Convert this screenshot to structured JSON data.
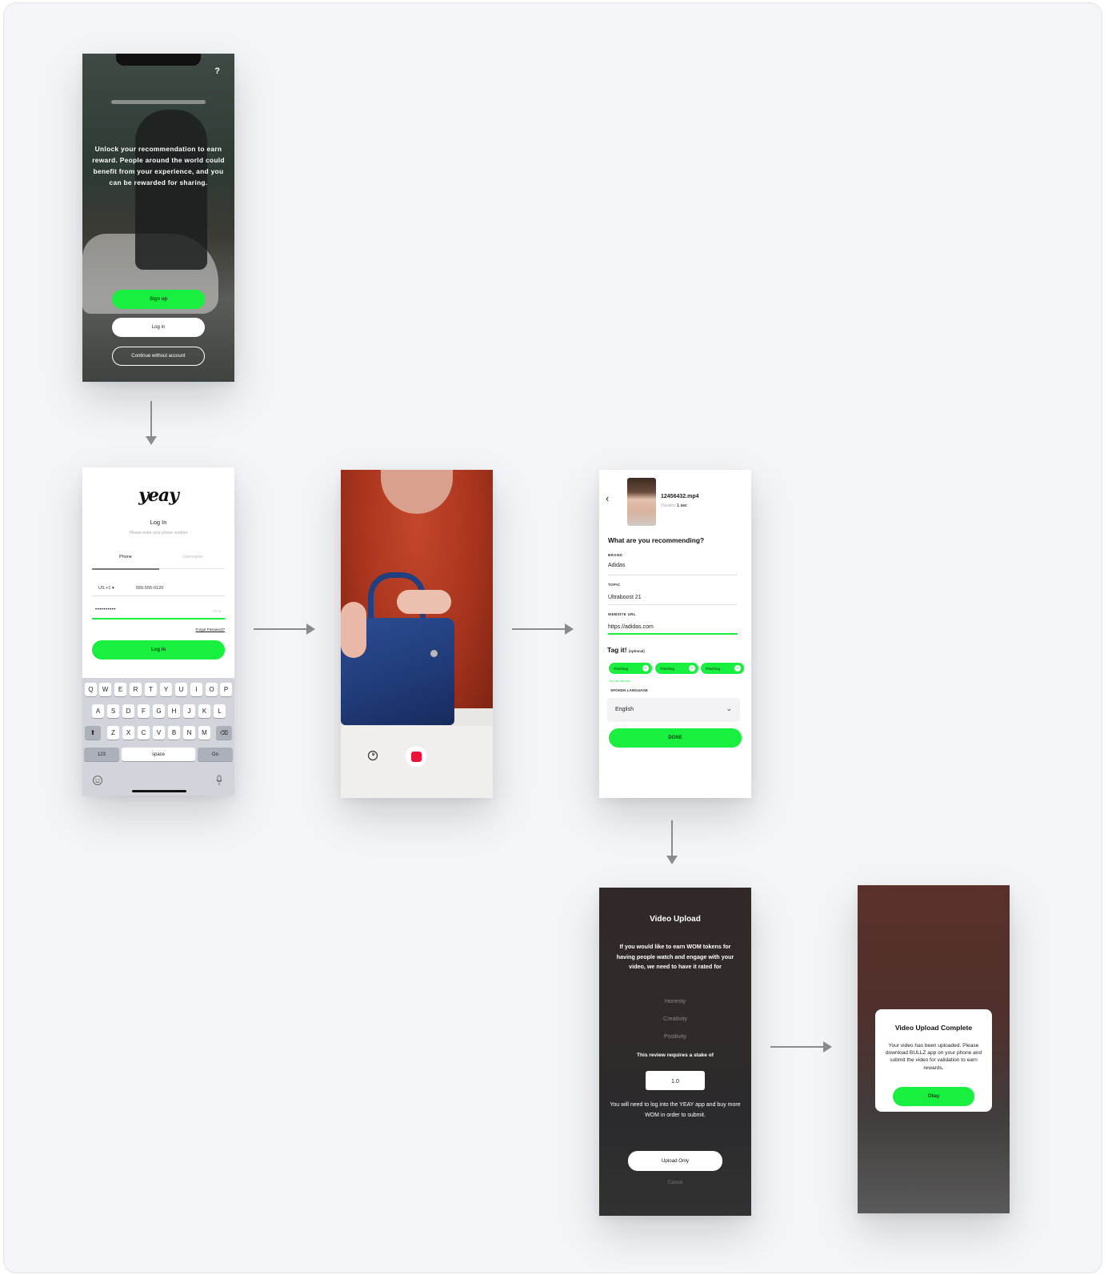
{
  "welcome": {
    "help": "?",
    "message": "Unlock your recommendation to earn reward. People around the world could benefit from your experience, and you can be rewarded for sharing.",
    "signup_label": "Sign up",
    "login_label": "Log in",
    "guest_label": "Continue without account"
  },
  "login": {
    "logo": "yeay",
    "title": "Log In",
    "subtitle": "Please enter your phone number",
    "tabs": [
      "Phone",
      "Username"
    ],
    "country_code": "US +1",
    "phone": "555-555-0120",
    "password_mask": "••••••••••",
    "show_label": "Show",
    "forgot_label": "Forgot Password?",
    "login_button": "Log In",
    "keyboard": {
      "row1": [
        "Q",
        "W",
        "E",
        "R",
        "T",
        "Y",
        "U",
        "I",
        "O",
        "P"
      ],
      "row2": [
        "A",
        "S",
        "D",
        "F",
        "G",
        "H",
        "J",
        "K",
        "L"
      ],
      "row3": [
        "Z",
        "X",
        "C",
        "V",
        "B",
        "N",
        "M"
      ],
      "num_key": "123",
      "space_key": "space",
      "go_key": "Go"
    }
  },
  "details": {
    "filename": "12456432.mp4",
    "duration_label": "Duration",
    "duration_value": "1 sec",
    "question": "What are you recommending?",
    "brand_label": "BRAND",
    "brand_value": "Adidas",
    "topic_label": "TOPIC",
    "topic_value": "Ultraboost 21",
    "url_label": "WEBSITE URL",
    "url_value": "https://adidas.com",
    "tag_title": "Tag it!",
    "tag_optional": "(optional)",
    "tags": [
      "#hashtag",
      "#hashtag",
      "#hashtag"
    ],
    "tag_limit": "You are at max",
    "language_label": "SPOKEN LANGUAGE",
    "language_value": "English",
    "done_label": "DONE"
  },
  "upload": {
    "title": "Video Upload",
    "description": "If you would like to earn WOM tokens for having people watch and engage with your video, we need to have it rated for",
    "criteria": [
      "Honesty",
      "Creativity",
      "Positivity"
    ],
    "stake_text": "This review requires a stake of",
    "stake_value": "1.0",
    "note": "You will need to log into the YEAY app and buy more WOM in order to submit.",
    "upload_only_label": "Upload Only",
    "cancel_label": "Cancel"
  },
  "complete": {
    "title": "Video Upload Complete",
    "message": "Your video has been uploaded. Please download BULLZ app on your phone and submit the video for validation to earn rewards.",
    "ok_label": "Okay"
  },
  "colors": {
    "accent": "#18ef3e",
    "record": "#e8143c",
    "board": "#f4f5f9",
    "arrow": "#8c8c8c"
  }
}
